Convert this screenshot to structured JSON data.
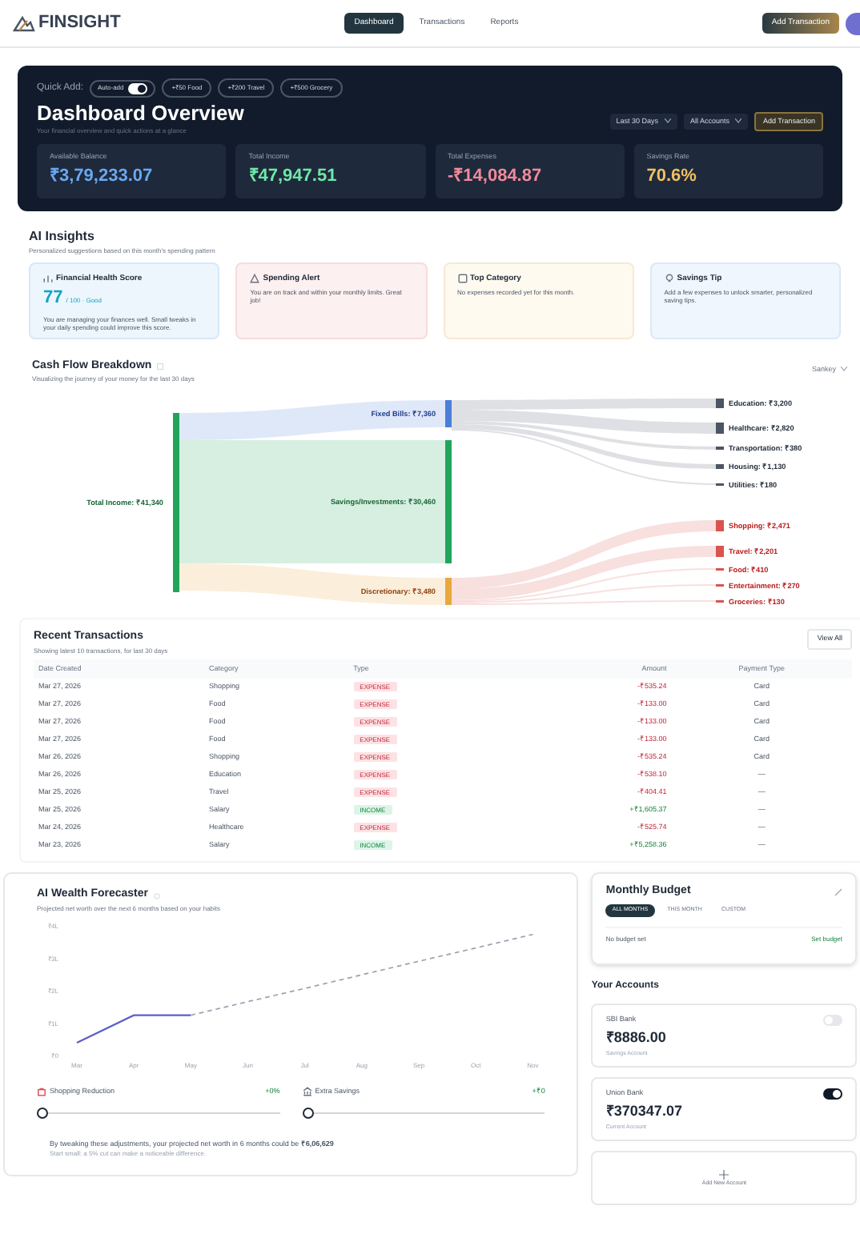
{
  "header": {
    "brand": "FINSIGHT",
    "nav": [
      {
        "label": "Dashboard",
        "selected": true
      },
      {
        "label": "Transactions",
        "selected": false
      },
      {
        "label": "Reports",
        "selected": false
      }
    ],
    "action": "Add Transaction"
  },
  "hero": {
    "quick_add_label": "Quick Add:",
    "auto_add": {
      "label": "Auto-add",
      "on": true
    },
    "chips": [
      "+₹50 Food",
      "+₹200 Travel",
      "+₹500 Grocery"
    ],
    "title": "Dashboard Overview",
    "subtitle": "Your financial overview and quick actions at a glance",
    "period": "Last 30 Days",
    "accounts": "All Accounts",
    "add_button": "Add Transaction",
    "stats": [
      {
        "label": "Available Balance",
        "value": "₹3,79,233.07",
        "kind": "balance"
      },
      {
        "label": "Total Income",
        "value": "₹47,947.51",
        "kind": "income"
      },
      {
        "label": "Total Expenses",
        "value": "-₹14,084.87",
        "kind": "expense"
      },
      {
        "label": "Savings Rate",
        "value": "70.6%",
        "kind": "rate"
      }
    ]
  },
  "insights": {
    "title": "AI Insights",
    "subtitle": "Personalized suggestions based on this month's spending pattern",
    "cards": [
      {
        "kind": "score",
        "title": "Financial Health Score",
        "score": "77",
        "score_note": "/ 100 · Good",
        "text": "You are managing your finances well. Small tweaks in your daily spending could improve this score."
      },
      {
        "kind": "alert",
        "title": "Spending Alert",
        "text": "You are on track and within your monthly limits. Great job!"
      },
      {
        "kind": "category",
        "title": "Top Category",
        "text": "No expenses recorded yet for this month."
      },
      {
        "kind": "tip",
        "title": "Savings Tip",
        "text": "Add a few expenses to unlock smarter, personalized saving tips."
      }
    ]
  },
  "cash_flow": {
    "title": "Cash Flow Breakdown",
    "subtitle": "Visualizing the journey of your money for the last 30 days",
    "view": "Sankey",
    "nodes": [
      {
        "label": "Total Income: ₹41,340",
        "color": "#22a55b"
      },
      {
        "label": "Fixed Bills: ₹7,360",
        "color": "#4a7fd8"
      },
      {
        "label": "Savings/Investments: ₹30,460",
        "color": "#22a55b"
      },
      {
        "label": "Discretionary: ₹3,480",
        "color": "#e8a93a"
      },
      {
        "label": "Education: ₹3,200",
        "color": "#4b5563"
      },
      {
        "label": "Healthcare: ₹2,820",
        "color": "#4b5563"
      },
      {
        "label": "Transportation: ₹380",
        "color": "#4b5563"
      },
      {
        "label": "Housing: ₹1,130",
        "color": "#4b5563"
      },
      {
        "label": "Utilities: ₹180",
        "color": "#4b5563"
      },
      {
        "label": "Shopping: ₹2,471",
        "color": "#d9534f"
      },
      {
        "label": "Travel: ₹2,201",
        "color": "#d9534f"
      },
      {
        "label": "Food: ₹410",
        "color": "#d9534f"
      },
      {
        "label": "Entertainment: ₹270",
        "color": "#d9534f"
      },
      {
        "label": "Groceries: ₹130",
        "color": "#d9534f"
      }
    ]
  },
  "transactions": {
    "title": "Recent Transactions",
    "subtitle": "Showing latest 10 transactions, for last 30 days",
    "view_all": "View All",
    "columns": [
      "Date Created",
      "Category",
      "Type",
      "Amount",
      "Payment Type"
    ],
    "rows": [
      {
        "date": "Mar 27, 2026",
        "category": "Shopping",
        "type": "EXPENSE",
        "kind": "expense",
        "amount": "-₹535.24",
        "payment": "Card"
      },
      {
        "date": "Mar 27, 2026",
        "category": "Food",
        "type": "EXPENSE",
        "kind": "expense",
        "amount": "-₹133.00",
        "payment": "Card"
      },
      {
        "date": "Mar 27, 2026",
        "category": "Food",
        "type": "EXPENSE",
        "kind": "expense",
        "amount": "-₹133.00",
        "payment": "Card"
      },
      {
        "date": "Mar 27, 2026",
        "category": "Food",
        "type": "EXPENSE",
        "kind": "expense",
        "amount": "-₹133.00",
        "payment": "Card"
      },
      {
        "date": "Mar 26, 2026",
        "category": "Shopping",
        "type": "EXPENSE",
        "kind": "expense",
        "amount": "-₹535.24",
        "payment": "Card"
      },
      {
        "date": "Mar 26, 2026",
        "category": "Education",
        "type": "EXPENSE",
        "kind": "expense",
        "amount": "-₹538.10",
        "payment": "—"
      },
      {
        "date": "Mar 25, 2026",
        "category": "Travel",
        "type": "EXPENSE",
        "kind": "expense",
        "amount": "-₹404.41",
        "payment": "—"
      },
      {
        "date": "Mar 25, 2026",
        "category": "Salary",
        "type": "INCOME",
        "kind": "income",
        "amount": "+₹1,605.37",
        "payment": "—"
      },
      {
        "date": "Mar 24, 2026",
        "category": "Healthcare",
        "type": "EXPENSE",
        "kind": "expense",
        "amount": "-₹525.74",
        "payment": "—"
      },
      {
        "date": "Mar 23, 2026",
        "category": "Salary",
        "type": "INCOME",
        "kind": "income",
        "amount": "+₹5,258.36",
        "payment": "—"
      }
    ]
  },
  "forecaster": {
    "title": "AI Wealth Forecaster",
    "subtitle": "Projected net worth over the next 6 months based on your habits",
    "chart_data": {
      "type": "line",
      "x": [
        "Mar",
        "Apr",
        "May",
        "Jun",
        "Jul",
        "Aug",
        "Sep",
        "Oct",
        "Nov"
      ],
      "yticks": [
        {
          "value": 0,
          "label": "₹0"
        },
        {
          "value": 1,
          "label": "₹1L"
        },
        {
          "value": 2,
          "label": "₹2L"
        },
        {
          "value": 3,
          "label": "₹3L"
        },
        {
          "value": 4,
          "label": "₹4L"
        }
      ],
      "ylim": [
        0,
        4
      ],
      "series": [
        {
          "color": "#5b5fc7",
          "line_style": "solid",
          "values": [
            0.4,
            1.25,
            1.25,
            null,
            null,
            null,
            null,
            null,
            null
          ]
        },
        {
          "color": "#9ca3af",
          "line_style": "dashed",
          "values": [
            null,
            null,
            1.25,
            1.67,
            2.08,
            2.5,
            2.92,
            3.33,
            3.75
          ]
        }
      ]
    },
    "sliders": [
      {
        "kind": "shopping",
        "label": "Shopping Reduction",
        "reading": "+0%",
        "level": 0
      },
      {
        "kind": "savings",
        "label": "Extra Savings",
        "reading": "+₹0",
        "level": 0
      }
    ],
    "summary": "By tweaking these adjustments, your projected net worth in 6 months could be **₹6,06,629**",
    "note": "Start small: a 5% cut can make a noticeable difference."
  },
  "budget": {
    "title": "Monthly Budget",
    "tabs": [
      {
        "label": "ALL MONTHS",
        "selected": true
      },
      {
        "label": "THIS MONTH",
        "selected": false
      },
      {
        "label": "CUSTOM",
        "selected": false
      }
    ],
    "status": "No budget set",
    "link": "Set budget"
  },
  "accounts": {
    "title": "Your Accounts",
    "items": [
      {
        "name": "SBI Bank",
        "balance": "₹8886.00",
        "type": "Savings Account",
        "on": false
      },
      {
        "name": "Union Bank",
        "balance": "₹370347.07",
        "type": "Current Account",
        "on": true
      }
    ],
    "add": "Add New Account"
  }
}
